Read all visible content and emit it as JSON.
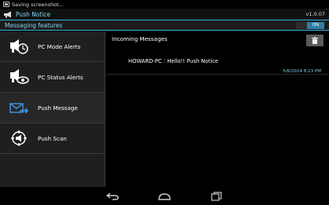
{
  "status_bar": {
    "text": "Saving screenshot..."
  },
  "app": {
    "title": "Push Notice",
    "version": "v1.0.07"
  },
  "section": {
    "title": "Messaging features",
    "toggle_label": "ON"
  },
  "sidebar": {
    "items": [
      {
        "label": "PC Mode Alerts",
        "icon": "pc-clock-icon"
      },
      {
        "label": "PC Status Alerts",
        "icon": "pc-eye-icon"
      },
      {
        "label": "Push Message",
        "icon": "envelope-arrow-icon"
      },
      {
        "label": "Push Scan",
        "icon": "scan-icon"
      }
    ],
    "selected_index": 2
  },
  "main": {
    "title": "Incoming Messages",
    "messages": [
      {
        "text": "HOWARD-PC : Hello!! Push Notice",
        "time": "5/6/2014 8:13 PM"
      }
    ]
  },
  "colors": {
    "accent": "#33b5e5",
    "accent_light": "#8ad4f2",
    "toggle_on": "#2f7ea7"
  }
}
